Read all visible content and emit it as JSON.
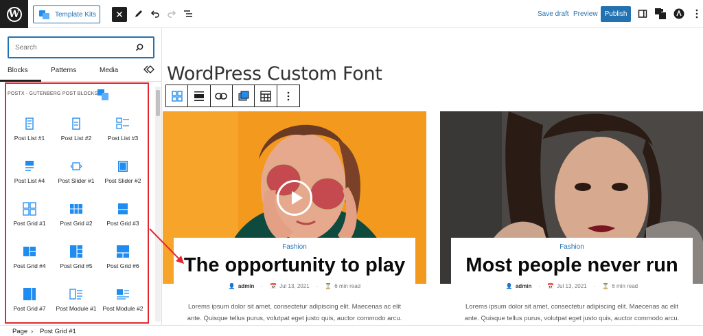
{
  "topbar": {
    "template_kits_label": "Template Kits",
    "save_draft_label": "Save draft",
    "preview_label": "Preview",
    "publish_label": "Publish"
  },
  "sidebar": {
    "search_placeholder": "Search",
    "tabs": [
      {
        "label": "Blocks",
        "active": true
      },
      {
        "label": "Patterns",
        "active": false
      },
      {
        "label": "Media",
        "active": false
      }
    ],
    "panel_title": "POSTX - GUTENBERG POST BLOCKS",
    "blocks": [
      {
        "label": "Post List #1",
        "icon": "post-list-1-icon"
      },
      {
        "label": "Post List #2",
        "icon": "post-list-2-icon"
      },
      {
        "label": "Post List #3",
        "icon": "post-list-3-icon"
      },
      {
        "label": "Post List #4",
        "icon": "post-list-4-icon"
      },
      {
        "label": "Post Slider #1",
        "icon": "post-slider-1-icon"
      },
      {
        "label": "Post Slider #2",
        "icon": "post-slider-2-icon"
      },
      {
        "label": "Post Grid #1",
        "icon": "post-grid-1-icon"
      },
      {
        "label": "Post Grid #2",
        "icon": "post-grid-2-icon"
      },
      {
        "label": "Post Grid #3",
        "icon": "post-grid-3-icon"
      },
      {
        "label": "Post Grid #4",
        "icon": "post-grid-4-icon"
      },
      {
        "label": "Post Grid #5",
        "icon": "post-grid-5-icon"
      },
      {
        "label": "Post Grid #6",
        "icon": "post-grid-6-icon"
      },
      {
        "label": "Post Grid #7",
        "icon": "post-grid-7-icon"
      },
      {
        "label": "Post Module #1",
        "icon": "post-module-1-icon"
      },
      {
        "label": "Post Module #2",
        "icon": "post-module-2-icon"
      }
    ]
  },
  "editor": {
    "post_title": "WordPress Custom Font",
    "cards": [
      {
        "category": "Fashion",
        "title": "The opportunity to play",
        "author": "admin",
        "date": "Jul 13, 2021",
        "read_time": "6 min read",
        "excerpt_line1": "Lorems ipsum dolor sit amet, consectetur adipiscing elit. Maecenas ac elit",
        "excerpt_line2": "ante. Quisque tellus purus, volutpat eget justo quis, auctor commodo arcu."
      },
      {
        "category": "Fashion",
        "title": "Most people never run",
        "author": "admin",
        "date": "Jul 13, 2021",
        "read_time": "6 min read",
        "excerpt_line1": "Lorems ipsum dolor sit amet, consectetur adipiscing elit. Maecenas ac elit",
        "excerpt_line2": "ante. Quisque tellus purus, volutpat eget justo quis, auctor commodo arcu."
      }
    ]
  },
  "breadcrumb": {
    "items": [
      "Page",
      "Post Grid #1"
    ]
  },
  "colors": {
    "accent": "#2271b1",
    "icon_blue": "#1e8cf0",
    "highlight_red": "#e3262f",
    "card1_bg": "#f39a1e"
  }
}
